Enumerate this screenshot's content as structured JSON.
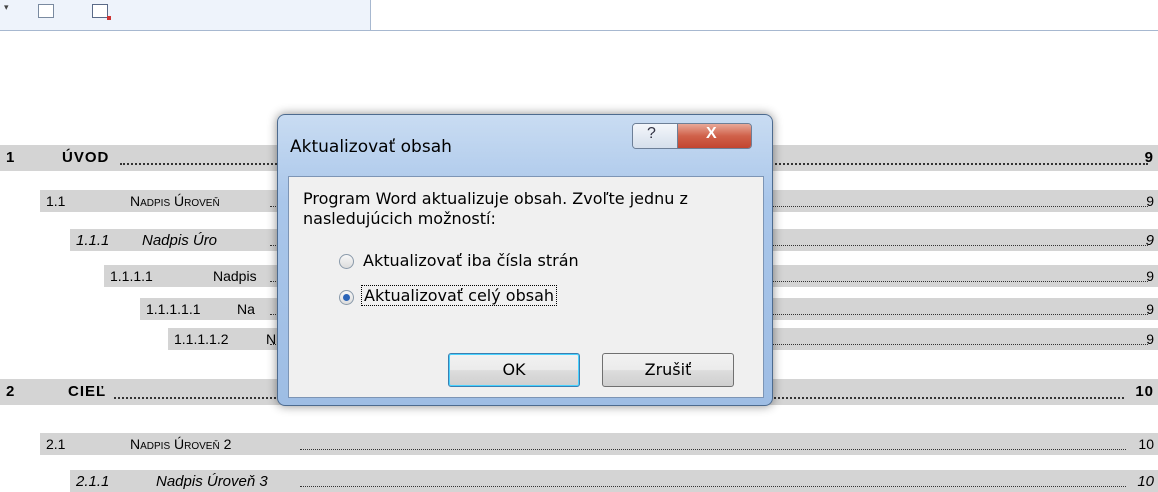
{
  "dialog": {
    "title": "Aktualizovať obsah",
    "message": "Program Word aktualizuje obsah. Zvoľte jednu z nasledujúcich možností:",
    "options": [
      {
        "label": "Aktualizovať iba čísla strán",
        "checked": false
      },
      {
        "label": "Aktualizovať celý obsah",
        "checked": true
      }
    ],
    "ok_label": "OK",
    "cancel_label": "Zrušiť",
    "help_icon": "?",
    "close_icon": "X"
  },
  "toc": [
    {
      "num": "1",
      "title": "ÚVOD",
      "page": "9"
    },
    {
      "num": "1.1",
      "title": "Nadpis Úroveň",
      "page": "9"
    },
    {
      "num": "1.1.1",
      "title": "Nadpis Úro",
      "page": "9"
    },
    {
      "num": "1.1.1.1",
      "title": "Nadpis",
      "page": "9"
    },
    {
      "num": "1.1.1.1.1",
      "title": "Na",
      "page": "9"
    },
    {
      "num": "1.1.1.1.2",
      "title": "N",
      "page": "9"
    },
    {
      "num": "2",
      "title": "CIEĽ",
      "page": "10"
    },
    {
      "num": "2.1",
      "title": "Nadpis Úroveň 2",
      "page": "10"
    },
    {
      "num": "2.1.1",
      "title": "Nadpis Úroveň 3",
      "page": "10"
    }
  ]
}
